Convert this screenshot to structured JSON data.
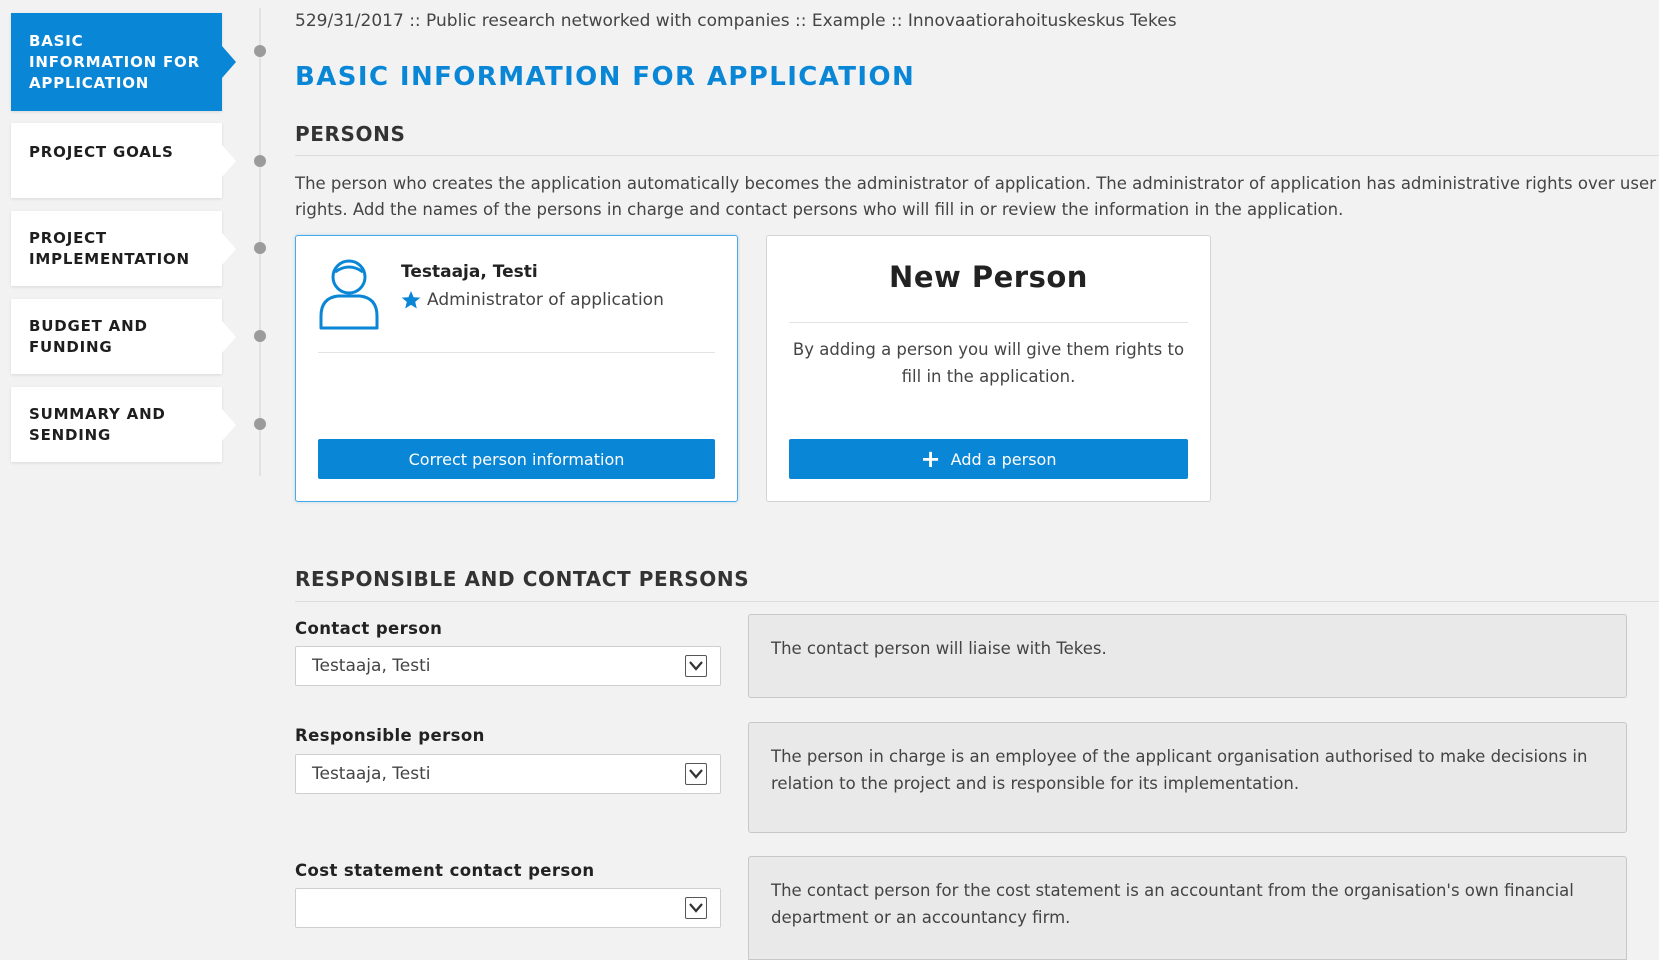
{
  "sidebar": {
    "items": [
      {
        "label": "BASIC INFORMATION FOR APPLICATION",
        "active": true
      },
      {
        "label": "PROJECT GOALS",
        "active": false
      },
      {
        "label": "PROJECT IMPLEMENTATION",
        "active": false
      },
      {
        "label": "BUDGET AND FUNDING",
        "active": false
      },
      {
        "label": "SUMMARY AND SENDING",
        "active": false
      }
    ]
  },
  "header": {
    "breadcrumb": "529/31/2017 :: Public research networked with companies :: Example :: Innovaatiorahoituskeskus Tekes",
    "title": "BASIC INFORMATION FOR APPLICATION"
  },
  "persons": {
    "section_title": "PERSONS",
    "intro": "The person who creates the application automatically becomes the administrator of application. The administrator of application has administrative rights over user rights. Add the names of the persons in charge and contact persons who will fill in or review the information in the application.",
    "person_card": {
      "name": "Testaaja, Testi",
      "role": "Administrator of application",
      "button_label": "Correct person information"
    },
    "new_person_card": {
      "title": "New Person",
      "description": "By adding a person you will give them rights to fill in the application.",
      "button_label": "Add a person"
    }
  },
  "responsible": {
    "section_title": "RESPONSIBLE AND CONTACT PERSONS",
    "fields": [
      {
        "label": "Contact person",
        "value": "Testaaja, Testi",
        "help": "The contact person will liaise with Tekes."
      },
      {
        "label": "Responsible person",
        "value": "Testaaja, Testi",
        "help": "The person in charge is an employee of the applicant organisation authorised to make decisions in relation to the project and is responsible for its implementation."
      },
      {
        "label": "Cost statement contact person",
        "value": "",
        "help": "The contact person for the cost statement is an accountant from the organisation's own financial department or an accountancy firm."
      }
    ]
  },
  "colors": {
    "accent": "#0a86d6",
    "background": "#f2f2f2",
    "info_box": "#e9e9e9"
  },
  "icons": {
    "person": "person-outline-icon",
    "star": "star-icon",
    "plus": "plus-icon",
    "dropdown": "chevron-down-icon"
  }
}
